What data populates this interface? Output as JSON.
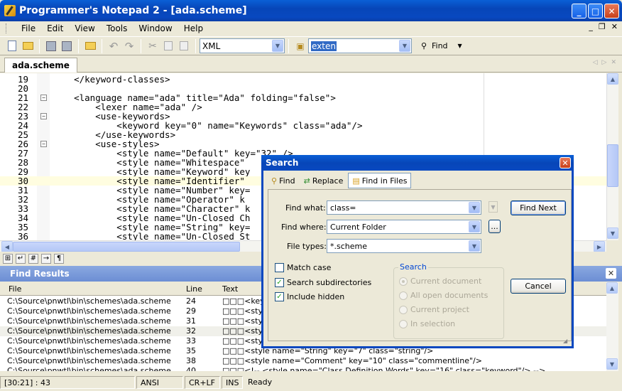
{
  "window": {
    "title": "Programmer's Notepad 2 - [ada.scheme]"
  },
  "menu": [
    "File",
    "Edit",
    "View",
    "Tools",
    "Window",
    "Help"
  ],
  "toolbar": {
    "scheme_select": "XML",
    "find_box": "exten",
    "find_label": "Find"
  },
  "tab": {
    "label": "ada.scheme"
  },
  "editor": {
    "lines": [
      {
        "n": "19",
        "code": "    </keyword-classes>"
      },
      {
        "n": "20",
        "code": ""
      },
      {
        "n": "21",
        "code": "    <language name=\"ada\" title=\"Ada\" folding=\"false\">"
      },
      {
        "n": "22",
        "code": "        <lexer name=\"ada\" />"
      },
      {
        "n": "23",
        "code": "        <use-keywords>"
      },
      {
        "n": "24",
        "code": "            <keyword key=\"0\" name=\"Keywords\" class=\"ada\"/>"
      },
      {
        "n": "25",
        "code": "        </use-keywords>"
      },
      {
        "n": "26",
        "code": "        <use-styles>"
      },
      {
        "n": "27",
        "code": "            <style name=\"Default\" key=\"32\" />"
      },
      {
        "n": "28",
        "code": "            <style name=\"Whitespace\""
      },
      {
        "n": "29",
        "code": "            <style name=\"Keyword\" key"
      },
      {
        "n": "30",
        "code": "            <style name=\"Identifier\""
      },
      {
        "n": "31",
        "code": "            <style name=\"Number\" key="
      },
      {
        "n": "32",
        "code": "            <style name=\"Operator\" k"
      },
      {
        "n": "33",
        "code": "            <style name=\"Character\" k"
      },
      {
        "n": "34",
        "code": "            <style name=\"Un-Closed Ch"
      },
      {
        "n": "35",
        "code": "            <style name=\"String\" key="
      },
      {
        "n": "36",
        "code": "            <style name=\"Un-Closed St"
      }
    ]
  },
  "find_results": {
    "title": "Find Results",
    "columns": [
      "File",
      "Line",
      "Text"
    ],
    "rows": [
      {
        "file": "C:\\Source\\pnwtl\\bin\\schemes\\ada.scheme",
        "line": "24",
        "text": "□□□<key"
      },
      {
        "file": "C:\\Source\\pnwtl\\bin\\schemes\\ada.scheme",
        "line": "29",
        "text": "□□□<style"
      },
      {
        "file": "C:\\Source\\pnwtl\\bin\\schemes\\ada.scheme",
        "line": "31",
        "text": "□□□<style"
      },
      {
        "file": "C:\\Source\\pnwtl\\bin\\schemes\\ada.scheme",
        "line": "32",
        "text": "□□□<style"
      },
      {
        "file": "C:\\Source\\pnwtl\\bin\\schemes\\ada.scheme",
        "line": "33",
        "text": "□□□<style"
      },
      {
        "file": "C:\\Source\\pnwtl\\bin\\schemes\\ada.scheme",
        "line": "35",
        "text": "□□□<style name=\"String\" key=\"7\" class=\"string\"/>"
      },
      {
        "file": "C:\\Source\\pnwtl\\bin\\schemes\\ada.scheme",
        "line": "38",
        "text": "□□□<style name=\"Comment\" key=\"10\" class=\"commentline\"/>"
      },
      {
        "file": "C:\\Source\\pnwtl\\bin\\schemes\\ada.scheme",
        "line": "40",
        "text": "□□□<!-- <style name=\"Class Definition Words\" key=\"16\" class=\"keyword\"/> -->"
      }
    ]
  },
  "status": {
    "pos": "[30:21] : 43",
    "encoding": "ANSI",
    "eol": "CR+LF",
    "mode": "INS",
    "state": "Ready"
  },
  "dialog": {
    "title": "Search",
    "tabs": [
      "Find",
      "Replace",
      "Find in Files"
    ],
    "find_what_label": "Find what:",
    "find_what": "class=",
    "find_where_label": "Find where:",
    "find_where": "Current Folder",
    "browse": "...",
    "file_types_label": "File types:",
    "file_types": "*.scheme",
    "find_next": "Find Next",
    "cancel": "Cancel",
    "match_case": "Match case",
    "search_subdirs": "Search subdirectories",
    "include_hidden": "Include hidden",
    "group_label": "Search",
    "radios": [
      "Current document",
      "All open documents",
      "Current project",
      "In selection"
    ]
  }
}
